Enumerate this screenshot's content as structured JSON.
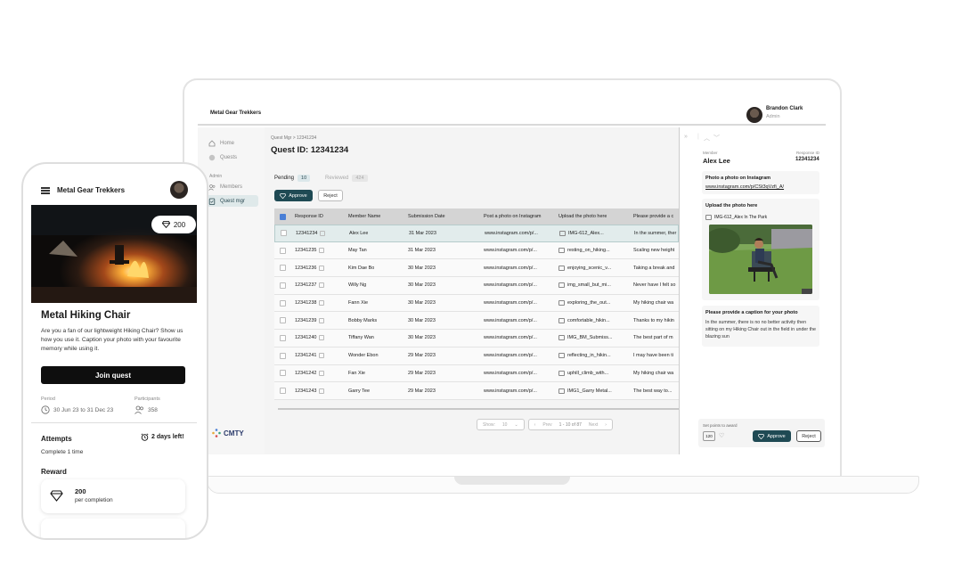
{
  "laptop": {
    "org_name": "Metal Gear Trekkers",
    "user": {
      "name": "Brandon Clark",
      "role": "Admin"
    },
    "sidebar": {
      "items": [
        {
          "label": "Home"
        },
        {
          "label": "Quests"
        }
      ],
      "section_label": "Admin",
      "admin_items": [
        {
          "label": "Members"
        },
        {
          "label": "Quest mgr"
        }
      ],
      "brand": "CMTY"
    },
    "main": {
      "breadcrumb": "Quest Mgr > 12341234",
      "title": "Quest ID: 12341234",
      "tabs": [
        {
          "label": "Pending",
          "count": "10"
        },
        {
          "label": "Reviewed",
          "count": "424"
        }
      ],
      "approve_label": "Approve",
      "reject_label": "Reject",
      "columns": [
        "Response ID",
        "Member Name",
        "Submission Date",
        "Post a photo on Instagram",
        "Upload the photo here",
        "Please provide a c"
      ],
      "rows": [
        {
          "id": "12341234",
          "name": "Alex Lee",
          "date": "31 Mar 2023",
          "ig": "www.instagram.com/p/...",
          "file": "IMG-612_Alex...",
          "caption": "In the summer, ther"
        },
        {
          "id": "12341235",
          "name": "May Tan",
          "date": "31 Mar 2023",
          "ig": "www.instagram.com/p/...",
          "file": "resting_on_hiking...",
          "caption": "Scaling new height"
        },
        {
          "id": "12341236",
          "name": "Kim Dae Bo",
          "date": "30 Mar 2023",
          "ig": "www.instagram.com/p/...",
          "file": "enjoying_scenic_v...",
          "caption": "Taking a break and"
        },
        {
          "id": "12341237",
          "name": "Willy Ng",
          "date": "30 Mar 2023",
          "ig": "www.instagram.com/p/...",
          "file": "img_small_but_mi...",
          "caption": "Never have I felt so"
        },
        {
          "id": "12341238",
          "name": "Fann Xie",
          "date": "30 Mar 2023",
          "ig": "www.instagram.com/p/...",
          "file": "exploring_the_out...",
          "caption": "My hiking chair wa"
        },
        {
          "id": "12341239",
          "name": "Bobby Marks",
          "date": "30 Mar 2023",
          "ig": "www.instagram.com/p/...",
          "file": "comfortable_hikin...",
          "caption": "Thanks to my hikin"
        },
        {
          "id": "12341240",
          "name": "Tiffany Wan",
          "date": "30 Mar 2023",
          "ig": "www.instagram.com/p/...",
          "file": "IMG_BM_Submiss...",
          "caption": "The best part of m"
        },
        {
          "id": "12341241",
          "name": "Wonder Ebon",
          "date": "29 Mar 2023",
          "ig": "www.instagram.com/p/...",
          "file": "reflecting_in_hikin...",
          "caption": "I may have been ti"
        },
        {
          "id": "12341242",
          "name": "Fan Xie",
          "date": "29 Mar 2023",
          "ig": "www.instagram.com/p/...",
          "file": "uphill_climb_with...",
          "caption": "My hiking chair wa"
        },
        {
          "id": "12341243",
          "name": "Garry Tee",
          "date": "29 Mar 2023",
          "ig": "www.instagram.com/p/...",
          "file": "IMG1_Garry Metal...",
          "caption": "The best way to..."
        }
      ],
      "pager": {
        "show_label": "Show:",
        "show_value": "10",
        "prev_label": "Prev",
        "range": "1 - 10 of 87",
        "next_label": "Next"
      }
    },
    "panel": {
      "member_label": "Member",
      "member_name": "Alex Lee",
      "response_label": "Response ID",
      "response_id": "12341234",
      "ig_title": "Photo a photo on Instagram",
      "ig_link": "www.instagram.com/p/CSt3qVzfi_A/",
      "upload_title": "Upload the photo here",
      "file_name": "IMG-612_Alex In The Park",
      "caption_title": "Please provide a caption for your photo",
      "caption_text": "In the summer, there is no no better activity then sitting on my Hiking Chair out in the field in under the blazing sun",
      "points_label": "Set points to award",
      "points_value": "120",
      "approve_label": "Approve",
      "reject_label": "Reject"
    }
  },
  "phone": {
    "org_name": "Metal Gear Trekkers",
    "points": "200",
    "title": "Metal Hiking Chair",
    "description": "Are you a fan of our lightweight Hiking Chair? Show us how you use it. Caption your photo with your favourite memory while using it.",
    "join_label": "Join quest",
    "period_label": "Period",
    "period_value": "30 Jun 23 to 31 Dec 23",
    "participants_label": "Participants",
    "participants_value": "358",
    "attempts_label": "Attempts",
    "days_left": "2 days left!",
    "attempts_value": "Complete 1 time",
    "reward_label": "Reward",
    "reward_value": "200",
    "reward_sub": "per completion"
  },
  "colors": {
    "primary": "#1f4a54",
    "selected_row": "#e2ecec",
    "checkbox": "#4a7fd6"
  }
}
